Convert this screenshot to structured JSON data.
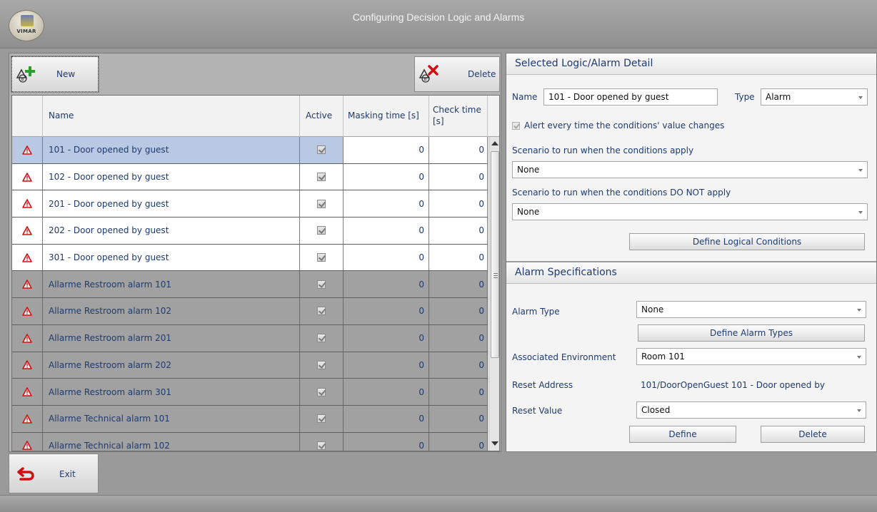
{
  "window": {
    "title": "Configuring Decision Logic and Alarms",
    "logo_text": "VIMAR"
  },
  "toolbar": {
    "new_label": "New",
    "delete_label": "Delete"
  },
  "grid": {
    "columns": [
      "Name",
      "Active",
      "Masking time [s]",
      "Check time [s]"
    ],
    "rows": [
      {
        "name": "101 - Door opened by guest",
        "active": true,
        "masking": "0",
        "check": "0",
        "style": "sel"
      },
      {
        "name": "102 - Door opened by guest",
        "active": true,
        "masking": "0",
        "check": "0",
        "style": "white"
      },
      {
        "name": "201 - Door opened by guest",
        "active": true,
        "masking": "0",
        "check": "0",
        "style": "white"
      },
      {
        "name": "202 - Door opened by guest",
        "active": true,
        "masking": "0",
        "check": "0",
        "style": "white"
      },
      {
        "name": "301 - Door opened by guest",
        "active": true,
        "masking": "0",
        "check": "0",
        "style": "white"
      },
      {
        "name": "Allarme Restroom alarm 101",
        "active": true,
        "masking": "0",
        "check": "0",
        "style": "gray"
      },
      {
        "name": "Allarme Restroom alarm 102",
        "active": true,
        "masking": "0",
        "check": "0",
        "style": "gray"
      },
      {
        "name": "Allarme Restroom alarm 201",
        "active": true,
        "masking": "0",
        "check": "0",
        "style": "gray"
      },
      {
        "name": "Allarme Restroom alarm 202",
        "active": true,
        "masking": "0",
        "check": "0",
        "style": "gray"
      },
      {
        "name": "Allarme Restroom alarm 301",
        "active": true,
        "masking": "0",
        "check": "0",
        "style": "gray"
      },
      {
        "name": "Allarme Technical alarm 101",
        "active": true,
        "masking": "0",
        "check": "0",
        "style": "gray"
      },
      {
        "name": "Allarme Technical alarm 102",
        "active": true,
        "masking": "0",
        "check": "0",
        "style": "gray"
      }
    ]
  },
  "detail": {
    "heading": "Selected Logic/Alarm Detail",
    "name_label": "Name",
    "name_value": "101 - Door opened by guest",
    "type_label": "Type",
    "type_value": "Alarm",
    "alert_every_time_label": "Alert every time the conditions' value changes",
    "scenario_apply_label": "Scenario to run when the conditions apply",
    "scenario_apply_value": "None",
    "scenario_not_apply_label": "Scenario to run when the conditions DO NOT apply",
    "scenario_not_apply_value": "None",
    "define_conditions_label": "Define Logical Conditions"
  },
  "alarm_spec": {
    "heading": "Alarm Specifications",
    "alarm_type_label": "Alarm Type",
    "alarm_type_value": "None",
    "define_alarm_types_label": "Define Alarm Types",
    "environment_label": "Associated Environment",
    "environment_value": "Room 101",
    "reset_address_label": "Reset Address",
    "reset_address_value": "101/DoorOpenGuest 101 - Door opened by",
    "reset_value_label": "Reset Value",
    "reset_value_value": "Closed",
    "define_label": "Define",
    "delete_label": "Delete"
  },
  "footer": {
    "exit_label": "Exit"
  },
  "colors": {
    "accent_text": "#1e3a6e",
    "warning_red": "#d01010",
    "selected_row": "#b9c8e3"
  }
}
